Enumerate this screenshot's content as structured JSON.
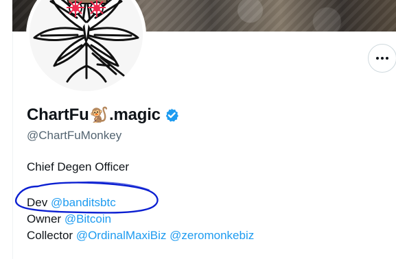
{
  "profile": {
    "name_before_emoji": "ChartFu",
    "name_emoji": "🐒",
    "name_after_emoji": ".magic",
    "handle": "@ChartFuMonkey",
    "bio_title": "Chief Degen Officer",
    "bio_lines": [
      {
        "label": "Dev",
        "mentions": [
          "@banditsbtc"
        ]
      },
      {
        "label": "Owner",
        "mentions": [
          "@Bitcoin"
        ]
      },
      {
        "label": "Collector",
        "mentions": [
          "@OrdinalMaxiBiz",
          "@zeromonkebiz"
        ]
      }
    ]
  },
  "icons": {
    "more_button": "more-horizontal-icon",
    "verified_badge": "verified-badge-icon",
    "avatar": "cannabis-leaf-avatar",
    "annotation": "blue-hand-drawn-ellipse"
  },
  "colors": {
    "primary_text": "#0f1419",
    "secondary_text": "#536471",
    "link": "#1d9bf0",
    "verified": "#1d9bf0",
    "annotation": "#0b1fd1"
  }
}
